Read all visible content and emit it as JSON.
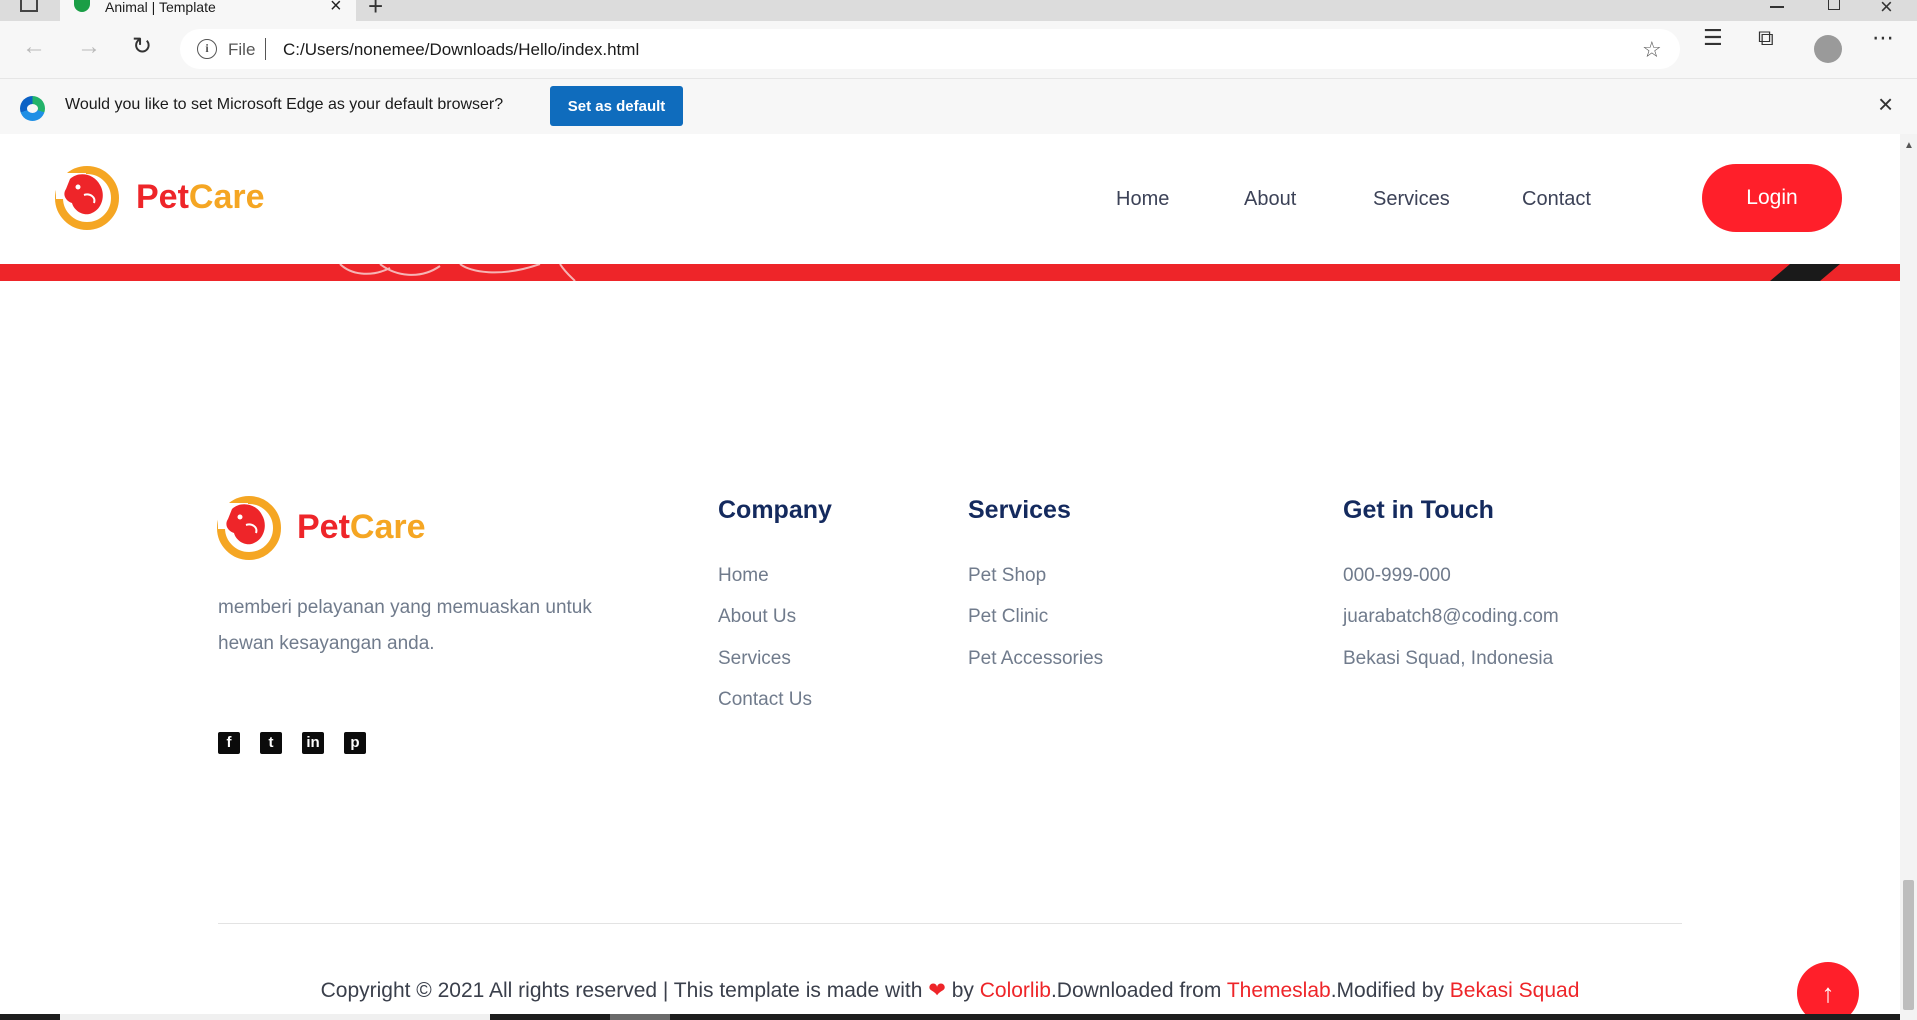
{
  "browser": {
    "tab_title": "Animal | Template",
    "address_prefix": "File",
    "url": "C:/Users/nonemee/Downloads/Hello/index.html",
    "infobar_text": "Would you like to set Microsoft Edge as your default browser?",
    "infobar_button": "Set as default",
    "icons": [
      "tab-actions-icon",
      "tab-close-icon",
      "new-tab-icon",
      "back-icon",
      "forward-icon",
      "refresh-icon",
      "info-icon",
      "add-favorite-icon",
      "favorites-icon",
      "collections-icon",
      "profile-avatar",
      "more-icon",
      "edge-logo",
      "infobar-close-icon"
    ]
  },
  "header": {
    "logo_pet": "Pet",
    "logo_care": "Care",
    "nav": [
      {
        "label": "Home"
      },
      {
        "label": "About"
      },
      {
        "label": "Services"
      },
      {
        "label": "Contact"
      }
    ],
    "login_label": "Login"
  },
  "footer": {
    "logo_pet": "Pet",
    "logo_care": "Care",
    "description": "memberi pelayanan yang memuaskan untuk hewan kesayangan anda.",
    "social": [
      "facebook-icon",
      "twitter-icon",
      "linkedin-icon",
      "pinterest-icon"
    ],
    "company": {
      "title": "Company",
      "items": [
        "Home",
        "About Us",
        "Services",
        "Contact Us"
      ]
    },
    "services": {
      "title": "Services",
      "items": [
        "Pet Shop",
        "Pet Clinic",
        "Pet Accessories"
      ]
    },
    "contact": {
      "title": "Get in Touch",
      "items": [
        "000-999-000",
        "juarabatch8@coding.com",
        "Bekasi Squad, Indonesia"
      ]
    },
    "copyright": {
      "prefix": "Copyright © 2021 All rights reserved | This template is made with",
      "by": "by",
      "colorlib": "Colorlib",
      "downloaded": ".Downloaded from",
      "themeslab": "Themeslab",
      "modified": ".Modified by",
      "bekasi": "Bekasi Squad"
    }
  },
  "colors": {
    "brand_red": "#ee2529",
    "brand_orange": "#f5a623",
    "heading_navy": "#142a5e",
    "edge_blue": "#0f6cbd"
  }
}
